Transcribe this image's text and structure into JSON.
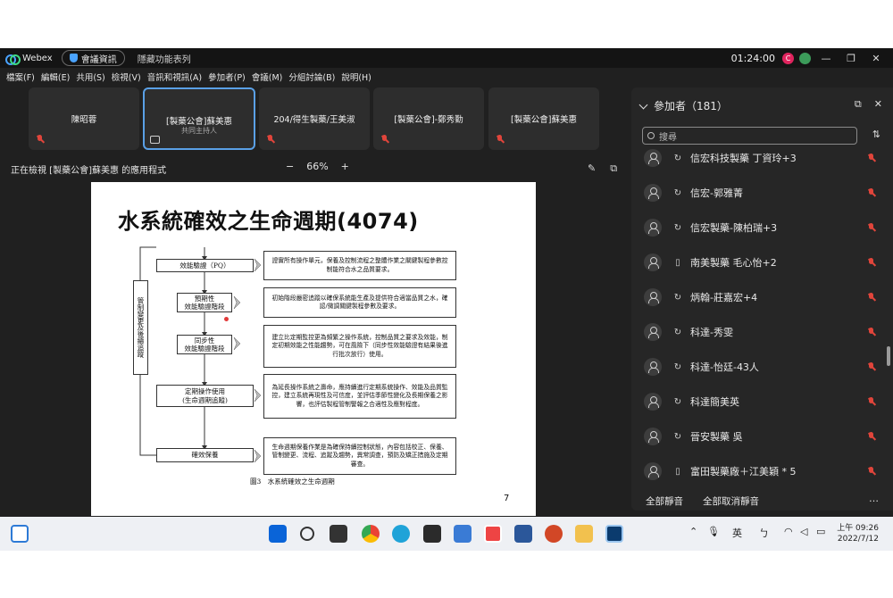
{
  "titlebar": {
    "app_name": "Webex",
    "meeting_info": "會議資訊",
    "hidden_menu": "隱藏功能表列",
    "timer": "01:24:00",
    "avatar_letter": "C"
  },
  "menu": [
    "檔案(F)",
    "編輯(E)",
    "共用(S)",
    "檢視(V)",
    "音訊和視訊(A)",
    "參加者(P)",
    "會議(M)",
    "分組討論(B)",
    "說明(H)"
  ],
  "tiles": [
    {
      "name": "陳昭蓉",
      "sub": ""
    },
    {
      "name": "[製藥公會]蘇美惠",
      "sub": "共同主持人"
    },
    {
      "name": "204/得生製藥/王美淑",
      "sub": ""
    },
    {
      "name": "[製藥公會]-鄭秀勤",
      "sub": ""
    },
    {
      "name": "[製藥公會]蘇美惠",
      "sub": ""
    }
  ],
  "viewing": {
    "label": "正在檢視 [製藥公會]蘇美惠 的應用程式",
    "zoom_minus": "−",
    "zoom": "66%",
    "zoom_plus": "+"
  },
  "slide": {
    "title": "水系統確效之生命週期(4074)",
    "flow": {
      "pq": "效能驗證（PQ）",
      "prospective_1": "預期性",
      "prospective_2": "效能驗證階段",
      "concurrent_1": "同步性",
      "concurrent_2": "效能驗證階段",
      "periodic_1": "定期操作使用",
      "periodic_2": "(生命週期追蹤)",
      "maintain": "確效保養",
      "side": "管制變更及後續追蹤"
    },
    "desc": [
      "證實所有操作單元，保養及控制流程之整體作業之關鍵製程參數控制能符合水之品質要求。",
      "初始階段嚴密追蹤以確保系統能生產及提供符合適當品質之水，確認/微調關鍵製程參數及要求。",
      "建立比定期監控更為頻繁之操作系統，控制品質之要求及效能，制定初期效能之性能趨勢，可在風險下（同步性效能驗證有結果後進行批次放行）使用。",
      "為延長操作系統之壽命，應持續進行定期系統操作、效能及品質監控，建立系統再現性及可信度，並評估季節性變化及長期保養之影響，也評估製程管制警報之合適性及應對程度。",
      "生命週期保養作業是為確保持續控制狀態，內容包括校正、保養、管制變更、流程、追蹤及趨勢，異常調查，預防及矯正措施及定期審查。"
    ],
    "caption": "圖3　水系統確效之生命週期",
    "page": "7"
  },
  "panel": {
    "title": "參加者（181）",
    "search_placeholder": "搜尋",
    "participants": [
      {
        "name": "信宏科技製藥 丁資玲+3",
        "device": "sync"
      },
      {
        "name": "信宏-郭雅菁",
        "device": "sync"
      },
      {
        "name": "信宏製藥-陳柏瑞+3",
        "device": "sync"
      },
      {
        "name": "南美製藥 毛心怡+2",
        "device": "phone"
      },
      {
        "name": "炳翰-莊嘉宏+4",
        "device": "sync"
      },
      {
        "name": "科達-秀雯",
        "device": "sync"
      },
      {
        "name": "科達-怡廷-43人",
        "device": "sync"
      },
      {
        "name": "科達簡美英",
        "device": "sync"
      },
      {
        "name": "晉安製藥 吳",
        "device": "sync"
      },
      {
        "name": "富田製藥廠＋江美穎 * 5",
        "device": "phone"
      }
    ],
    "mute_all": "全部靜音",
    "unmute_all": "全部取消靜音",
    "more": "…"
  },
  "taskbar": {
    "ime": "英",
    "ime2": "ㄅ",
    "time": "上午 09:26",
    "date": "2022/7/12"
  }
}
